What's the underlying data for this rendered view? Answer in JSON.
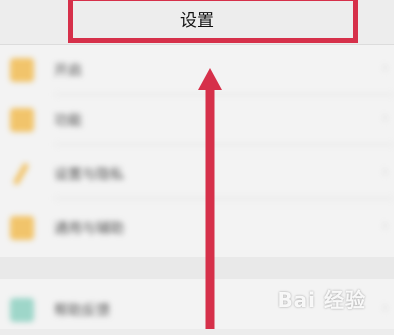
{
  "header": {
    "title": "设置"
  },
  "list": {
    "items": [
      {
        "label": "开启",
        "icon": "folder-icon",
        "color": "#f1c46b"
      },
      {
        "label": "功能",
        "icon": "folder-icon",
        "color": "#f1c46b"
      },
      {
        "label": "设置与隐私",
        "icon": "pencil-icon",
        "color": "#f1c46b"
      },
      {
        "label": "通用与辅助",
        "icon": "settings-icon",
        "color": "#f1c46b"
      },
      {
        "label": "帮助反馈",
        "icon": "help-icon",
        "color": "#9ed6c9"
      }
    ]
  },
  "annotation": {
    "box_color": "#d6304a",
    "arrow_color": "#d6304a"
  },
  "watermark": {
    "text": "Bai 经验"
  }
}
